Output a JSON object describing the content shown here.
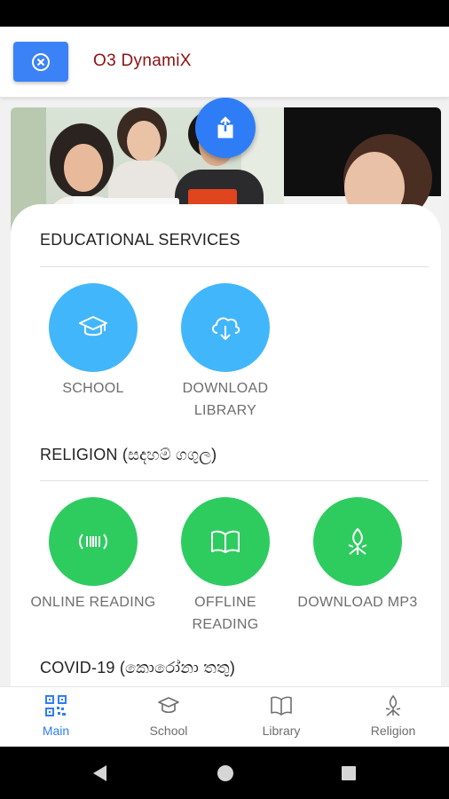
{
  "app": {
    "title": "O3 DynamiX"
  },
  "colors": {
    "primary": "#3b82f6",
    "title": "#8b1111",
    "circle_blue": "#42b6fb",
    "circle_green": "#2ecc5f"
  },
  "header": {
    "close_icon": "close-circle-icon"
  },
  "banner": {
    "share_icon": "share-upload-icon"
  },
  "sections": {
    "education": {
      "title": "EDUCATIONAL SERVICES",
      "tiles": [
        {
          "label": "SCHOOL",
          "icon": "graduation-cap-icon"
        },
        {
          "label": "DOWNLOAD LIBRARY",
          "icon": "cloud-download-icon"
        }
      ]
    },
    "religion": {
      "title": "RELIGION (සදහම් ගගුල)",
      "tiles": [
        {
          "label": "ONLINE READING",
          "icon": "broadcast-icon"
        },
        {
          "label": "OFFLINE READING",
          "icon": "book-open-icon"
        },
        {
          "label": "DOWNLOAD MP3",
          "icon": "lotus-icon"
        }
      ]
    },
    "covid": {
      "title": "COVID-19 (කොරෝනා තතු)"
    }
  },
  "bottom_nav": [
    {
      "label": "Main",
      "icon": "qr-code-icon",
      "active": true
    },
    {
      "label": "School",
      "icon": "graduation-cap-icon",
      "active": false
    },
    {
      "label": "Library",
      "icon": "book-icon",
      "active": false
    },
    {
      "label": "Religion",
      "icon": "lotus-icon",
      "active": false
    }
  ]
}
